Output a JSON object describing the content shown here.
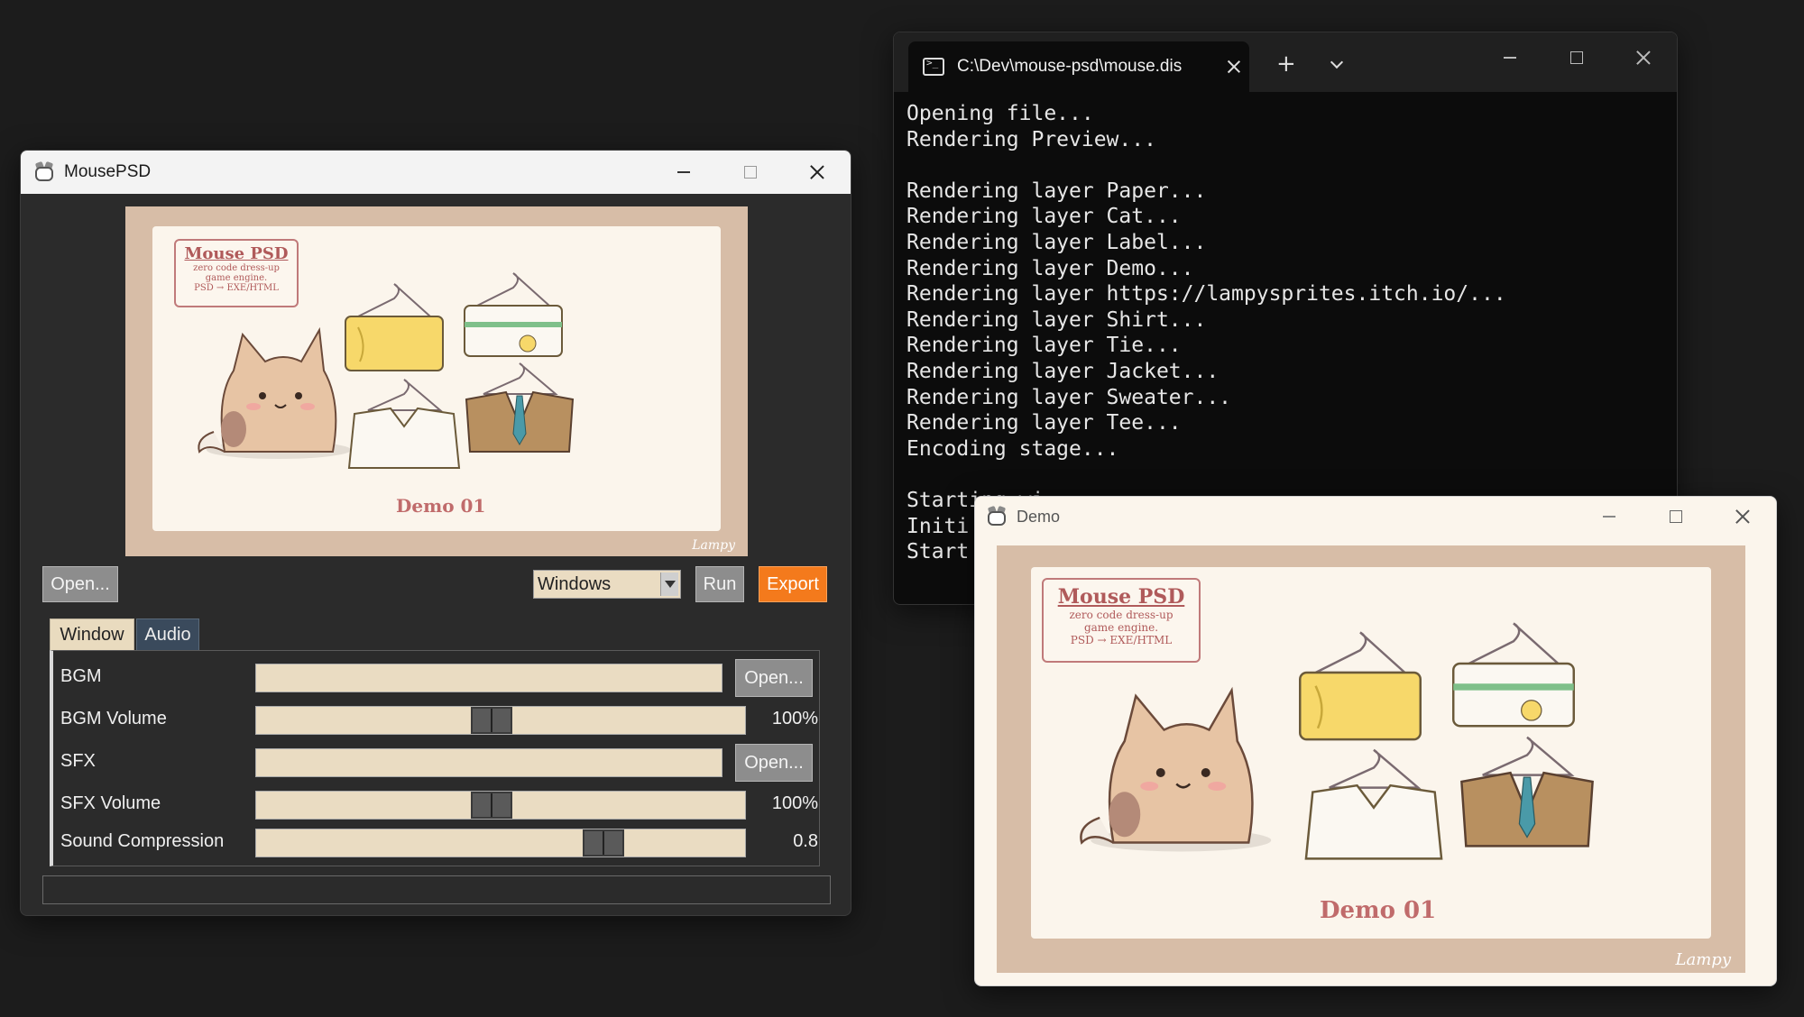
{
  "editor": {
    "title": "MousePSD",
    "preview": {
      "label_title": "Mouse PSD",
      "label_line1": "zero code dress-up",
      "label_line2": "game engine.",
      "label_line3": "PSD → EXE/HTML",
      "demo_text": "Demo 01",
      "signature": "Lampy"
    },
    "toolbar": {
      "open_label": "Open...",
      "platform_selected": "Windows",
      "run_label": "Run",
      "export_label": "Export"
    },
    "tabs": [
      {
        "label": "Window"
      },
      {
        "label": "Audio"
      }
    ],
    "audio": {
      "bgm_label": "BGM",
      "bgm_open": "Open...",
      "bgm_volume_label": "BGM Volume",
      "bgm_volume_value": "100%",
      "bgm_volume_level": 0.48,
      "sfx_label": "SFX",
      "sfx_open": "Open...",
      "sfx_volume_label": "SFX Volume",
      "sfx_volume_value": "100%",
      "sfx_volume_level": 0.48,
      "compression_label": "Sound Compression",
      "compression_value": "0.8",
      "compression_level": 0.73
    }
  },
  "terminal": {
    "tab_title": "C:\\Dev\\mouse-psd\\mouse.dis",
    "new_tab": "+",
    "lines": [
      "Opening file...",
      "Rendering Preview...",
      "",
      "Rendering layer Paper...",
      "Rendering layer Cat...",
      "Rendering layer Label...",
      "Rendering layer Demo...",
      "Rendering layer https://lampysprites.itch.io/...",
      "Rendering layer Shirt...",
      "Rendering layer Tie...",
      "Rendering layer Jacket...",
      "Rendering layer Sweater...",
      "Rendering layer Tee...",
      "Encoding stage...",
      "",
      "Starting wi",
      "Initi",
      "Start"
    ]
  },
  "demo": {
    "title": "Demo",
    "label_title": "Mouse PSD",
    "label_line1": "zero code dress-up",
    "label_line2": "game engine.",
    "label_line3": "PSD → EXE/HTML",
    "demo_text": "Demo 01",
    "signature": "Lampy"
  },
  "colors": {
    "desktop": "#1c1c1c",
    "export_accent": "#f47a1c",
    "field_fill": "#eadcc2",
    "paper": "#fbf5ec",
    "frame": "#d9bfa8"
  }
}
